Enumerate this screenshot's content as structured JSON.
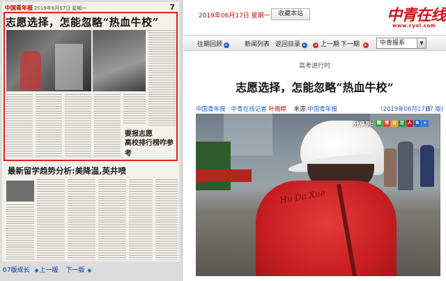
{
  "paper": {
    "masthead_logo": "中国青年报",
    "masthead_date": "2019年6月17日 星期一",
    "page_number": "7",
    "section_label": "成 长",
    "headline": "志愿选择，怎能忽略“热血牛校”",
    "sub_headline": "最新留学趋势分析:美降温,英井喷",
    "ad_line1": "要报志愿",
    "ad_line2": "高校排行榜咋参考",
    "nav": {
      "page_label": "07版成长",
      "prev_label": "上一版",
      "next_label": "下一版"
    }
  },
  "site": {
    "date_text": "2019年06月17日 星期一",
    "bookmark_label": "收藏本站",
    "logo_text": "中青在线",
    "url_text": "www.cyol.com",
    "navbar": {
      "items": [
        {
          "label": "往期回顾"
        },
        {
          "label": "新闻列表"
        },
        {
          "label": "返回目录"
        },
        {
          "label": "上一期"
        },
        {
          "label": "下一期"
        }
      ],
      "paper_select": "中青报系"
    },
    "article": {
      "kicker": "高考进行时",
      "title": "志愿选择，怎能忽略“热血牛校”",
      "byline_org": "中国青年报 · 中青在线记者",
      "byline_author": "叶雨婷",
      "source_label": "来源:",
      "source_value": "中国青年报",
      "date": "（2019年06月17日",
      "page": "07 版)",
      "photo_caption_text": "Hu Da Xue"
    },
    "share": {
      "label": "分享到:",
      "buttons": [
        {
          "name": "wechat",
          "color": "#3aa63a",
          "glyph": "微"
        },
        {
          "name": "weibo",
          "color": "#e0422f",
          "glyph": "博"
        },
        {
          "name": "qzone",
          "color": "#f2a22b",
          "glyph": "Q"
        },
        {
          "name": "douban",
          "color": "#2b8c3b",
          "glyph": "豆"
        },
        {
          "name": "people",
          "color": "#c0232a",
          "glyph": "人"
        },
        {
          "name": "renren",
          "color": "#1e6fd0",
          "glyph": "R"
        },
        {
          "name": "more",
          "color": "#2e7bd6",
          "glyph": "+"
        }
      ]
    }
  }
}
